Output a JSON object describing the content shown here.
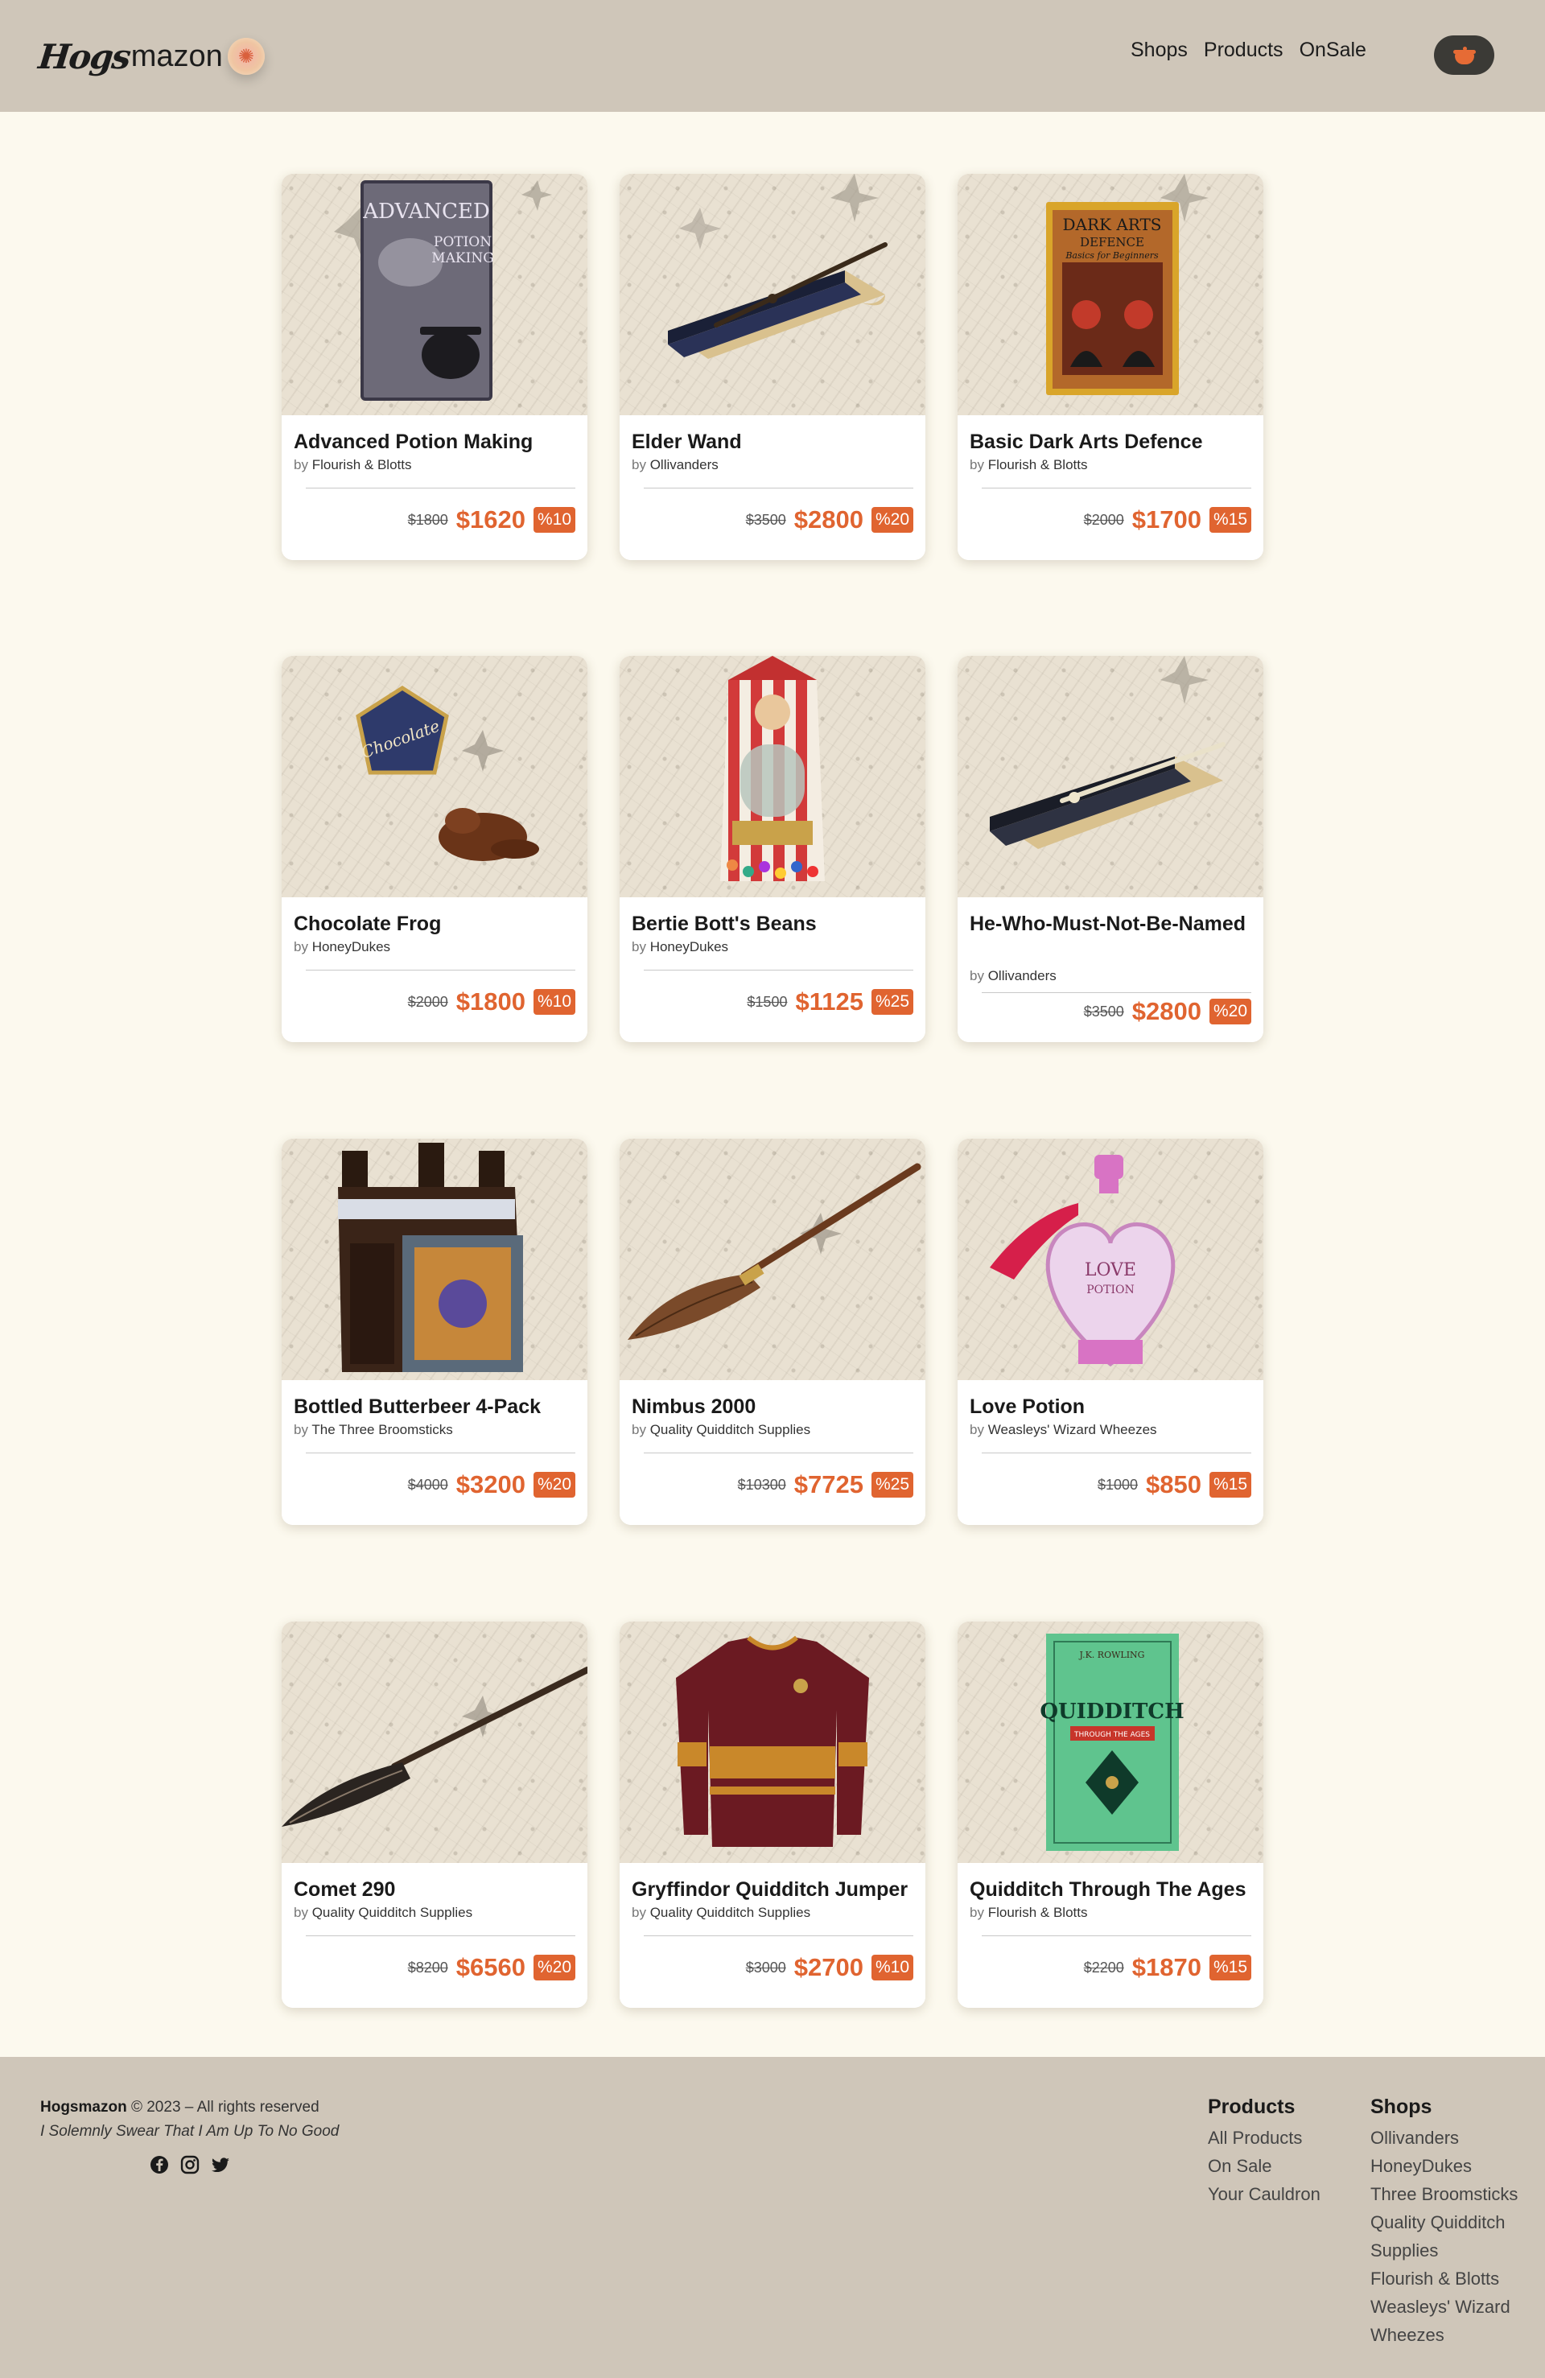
{
  "header": {
    "brand_hogs": "Hogs",
    "brand_mazon": "mazon",
    "nav": [
      "Shops",
      "Products",
      "OnSale"
    ]
  },
  "products": [
    {
      "title": "Advanced Potion Making",
      "by": "by",
      "shop": "Flourish & Blotts",
      "old_price": "$1800",
      "price": "$1620",
      "discount": "%10"
    },
    {
      "title": "Elder Wand",
      "by": "by",
      "shop": "Ollivanders",
      "old_price": "$3500",
      "price": "$2800",
      "discount": "%20"
    },
    {
      "title": "Basic Dark Arts Defence",
      "by": "by",
      "shop": "Flourish & Blotts",
      "old_price": "$2000",
      "price": "$1700",
      "discount": "%15"
    },
    {
      "title": "Chocolate Frog",
      "by": "by",
      "shop": "HoneyDukes",
      "old_price": "$2000",
      "price": "$1800",
      "discount": "%10"
    },
    {
      "title": "Bertie Bott's Beans",
      "by": "by",
      "shop": "HoneyDukes",
      "old_price": "$1500",
      "price": "$1125",
      "discount": "%25"
    },
    {
      "title": "He-Who-Must-Not-Be-Named",
      "by": "by",
      "shop": "Ollivanders",
      "old_price": "$3500",
      "price": "$2800",
      "discount": "%20"
    },
    {
      "title": "Bottled Butterbeer 4-Pack",
      "by": "by",
      "shop": "The Three Broomsticks",
      "old_price": "$4000",
      "price": "$3200",
      "discount": "%20"
    },
    {
      "title": "Nimbus 2000",
      "by": "by",
      "shop": "Quality Quidditch Supplies",
      "old_price": "$10300",
      "price": "$7725",
      "discount": "%25"
    },
    {
      "title": "Love Potion",
      "by": "by",
      "shop": "Weasleys' Wizard Wheezes",
      "old_price": "$1000",
      "price": "$850",
      "discount": "%15"
    },
    {
      "title": "Comet 290",
      "by": "by",
      "shop": "Quality Quidditch Supplies",
      "old_price": "$8200",
      "price": "$6560",
      "discount": "%20"
    },
    {
      "title": "Gryffindor Quidditch Jumper",
      "by": "by",
      "shop": "Quality Quidditch Supplies",
      "old_price": "$3000",
      "price": "$2700",
      "discount": "%10"
    },
    {
      "title": "Quidditch Through The Ages",
      "by": "by",
      "shop": "Flourish & Blotts",
      "old_price": "$2200",
      "price": "$1870",
      "discount": "%15"
    }
  ],
  "art_text": {
    "potion_book_1": "ADVANCED",
    "potion_book_2": "POTION",
    "potion_book_3": "MAKING",
    "dark_arts_1": "DARK ARTS",
    "dark_arts_2": "DEFENCE",
    "dark_arts_3": "Basics for Beginners",
    "frog_box": "Chocolate",
    "love_potion": "LOVE",
    "love_potion_2": "POTION",
    "quidditch_author": "J.K. ROWLING",
    "quidditch_title": "QUIDDITCH",
    "quidditch_sub": "THROUGH THE AGES"
  },
  "footer": {
    "brand": "Hogsmazon",
    "copyright": " © 2023 – All rights reserved",
    "motto": "I Solemnly Swear That I Am Up To No Good",
    "products_heading": "Products",
    "products_links": [
      "All Products",
      "On Sale",
      "Your Cauldron"
    ],
    "shops_heading": "Shops",
    "shops_links": [
      "Ollivanders",
      "HoneyDukes",
      "Three Broomsticks",
      "Quality Quidditch",
      "Supplies",
      "Flourish & Blotts",
      "Weasleys' Wizard",
      "Wheezes"
    ],
    "social_icons": [
      "facebook-icon",
      "instagram-icon",
      "twitter-icon"
    ]
  },
  "colors": {
    "accent": "#e06430",
    "header_bg": "#cfc6b9",
    "page_bg": "#fcf9ee"
  }
}
